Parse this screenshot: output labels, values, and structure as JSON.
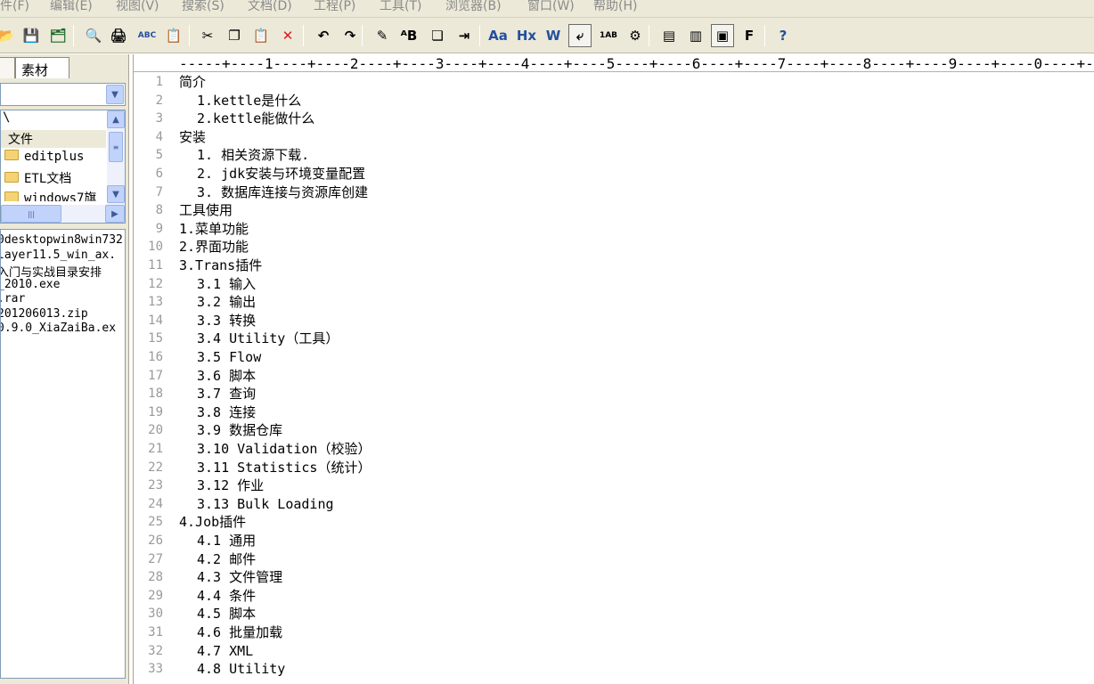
{
  "menubar": {
    "items": [
      "件(F)",
      "编辑(E)",
      "视图(V)",
      "搜索(S)",
      "文档(D)",
      "工程(P)",
      "工具(T)",
      "浏览器(B)",
      "窗口(W)",
      "帮助(H)"
    ]
  },
  "toolbar": {
    "buttons": [
      {
        "name": "open-icon",
        "glyph": "📂"
      },
      {
        "name": "save-icon",
        "glyph": "💾"
      },
      {
        "name": "save-all-icon",
        "glyph": "🗂"
      },
      {
        "name": "print-preview-icon",
        "glyph": "🔍"
      },
      {
        "name": "print-icon",
        "glyph": "🖨"
      },
      {
        "name": "spellcheck-icon",
        "glyph": "ABC"
      },
      {
        "name": "clipboard-icon",
        "glyph": "📋"
      },
      {
        "name": "cut-icon",
        "glyph": "✂"
      },
      {
        "name": "copy-icon",
        "glyph": "❐"
      },
      {
        "name": "paste-icon",
        "glyph": "📋"
      },
      {
        "name": "delete-icon",
        "glyph": "✕"
      },
      {
        "name": "undo-icon",
        "glyph": "↶"
      },
      {
        "name": "redo-icon",
        "glyph": "↷"
      },
      {
        "name": "find-icon",
        "glyph": "✎"
      },
      {
        "name": "replace-icon",
        "glyph": "ᴬB"
      },
      {
        "name": "copy-doc-icon",
        "glyph": "❏"
      },
      {
        "name": "indent-icon",
        "glyph": "⇥"
      },
      {
        "name": "font-icon",
        "glyph": "Aa"
      },
      {
        "name": "hex-icon",
        "glyph": "Hx"
      },
      {
        "name": "word-wrap-icon",
        "glyph": "W"
      },
      {
        "name": "line-wrap-icon",
        "glyph": "⤶"
      },
      {
        "name": "line-number-icon",
        "glyph": "1AB"
      },
      {
        "name": "settings-icon",
        "glyph": "⚙"
      },
      {
        "name": "view1-icon",
        "glyph": "▤"
      },
      {
        "name": "view2-icon",
        "glyph": "▥"
      },
      {
        "name": "view3-icon",
        "glyph": "▣"
      },
      {
        "name": "view4-icon",
        "glyph": "F"
      },
      {
        "name": "help-icon",
        "glyph": "?"
      }
    ]
  },
  "leftpanel": {
    "tab_label": "素材",
    "drive_value": "",
    "tree": {
      "root": "\\",
      "section": "文件",
      "folders": [
        "editplus",
        "ETL文档",
        "windows7旗"
      ]
    },
    "files": [
      "0desktopwin8win732",
      "layer11.5_win_ax.",
      "入门与实战目录安排",
      "_2010.exe",
      ".rar",
      "201206013.zip",
      "0.9.0_XiaZaiBa.ex"
    ]
  },
  "editor": {
    "ruler": "-----+----1----+----2----+----3----+----4----+----5----+----6----+----7----+----8----+----9----+----0----+--",
    "lines": [
      {
        "n": "1",
        "text": "简介",
        "indent": false
      },
      {
        "n": "2",
        "text": "1.kettle是什么",
        "indent": true
      },
      {
        "n": "3",
        "text": "2.kettle能做什么",
        "indent": true
      },
      {
        "n": "4",
        "text": "安装",
        "indent": false
      },
      {
        "n": "5",
        "text": "1. 相关资源下载.",
        "indent": true
      },
      {
        "n": "6",
        "text": "2. jdk安装与环境变量配置",
        "indent": true
      },
      {
        "n": "7",
        "text": "3. 数据库连接与资源库创建",
        "indent": true
      },
      {
        "n": "8",
        "text": "工具使用",
        "indent": false
      },
      {
        "n": "9",
        "text": "1.菜单功能",
        "indent": false
      },
      {
        "n": "10",
        "text": "2.界面功能",
        "indent": false
      },
      {
        "n": "11",
        "text": "3.Trans插件",
        "indent": false
      },
      {
        "n": "12",
        "text": "3.1 输入",
        "indent": true
      },
      {
        "n": "13",
        "text": "3.2 输出",
        "indent": true
      },
      {
        "n": "14",
        "text": "3.3 转换",
        "indent": true
      },
      {
        "n": "15",
        "text": "3.4 Utility（工具）",
        "indent": true
      },
      {
        "n": "16",
        "text": "3.5 Flow",
        "indent": true
      },
      {
        "n": "17",
        "text": "3.6 脚本",
        "indent": true
      },
      {
        "n": "18",
        "text": "3.7 查询",
        "indent": true
      },
      {
        "n": "19",
        "text": "3.8 连接",
        "indent": true
      },
      {
        "n": "20",
        "text": "3.9 数据仓库",
        "indent": true
      },
      {
        "n": "21",
        "text": "3.10 Validation（校验）",
        "indent": true
      },
      {
        "n": "22",
        "text": "3.11 Statistics（统计）",
        "indent": true
      },
      {
        "n": "23",
        "text": "3.12 作业",
        "indent": true
      },
      {
        "n": "24",
        "text": "3.13 Bulk Loading",
        "indent": true
      },
      {
        "n": "25",
        "text": "4.Job插件",
        "indent": false
      },
      {
        "n": "26",
        "text": "4.1 通用",
        "indent": true
      },
      {
        "n": "27",
        "text": "4.2 邮件",
        "indent": true
      },
      {
        "n": "28",
        "text": "4.3 文件管理",
        "indent": true
      },
      {
        "n": "29",
        "text": "4.4 条件",
        "indent": true
      },
      {
        "n": "30",
        "text": "4.5 脚本",
        "indent": true
      },
      {
        "n": "31",
        "text": "4.6 批量加载",
        "indent": true
      },
      {
        "n": "32",
        "text": "4.7 XML",
        "indent": true
      },
      {
        "n": "33",
        "text": "4.8 Utility",
        "indent": true
      }
    ]
  }
}
